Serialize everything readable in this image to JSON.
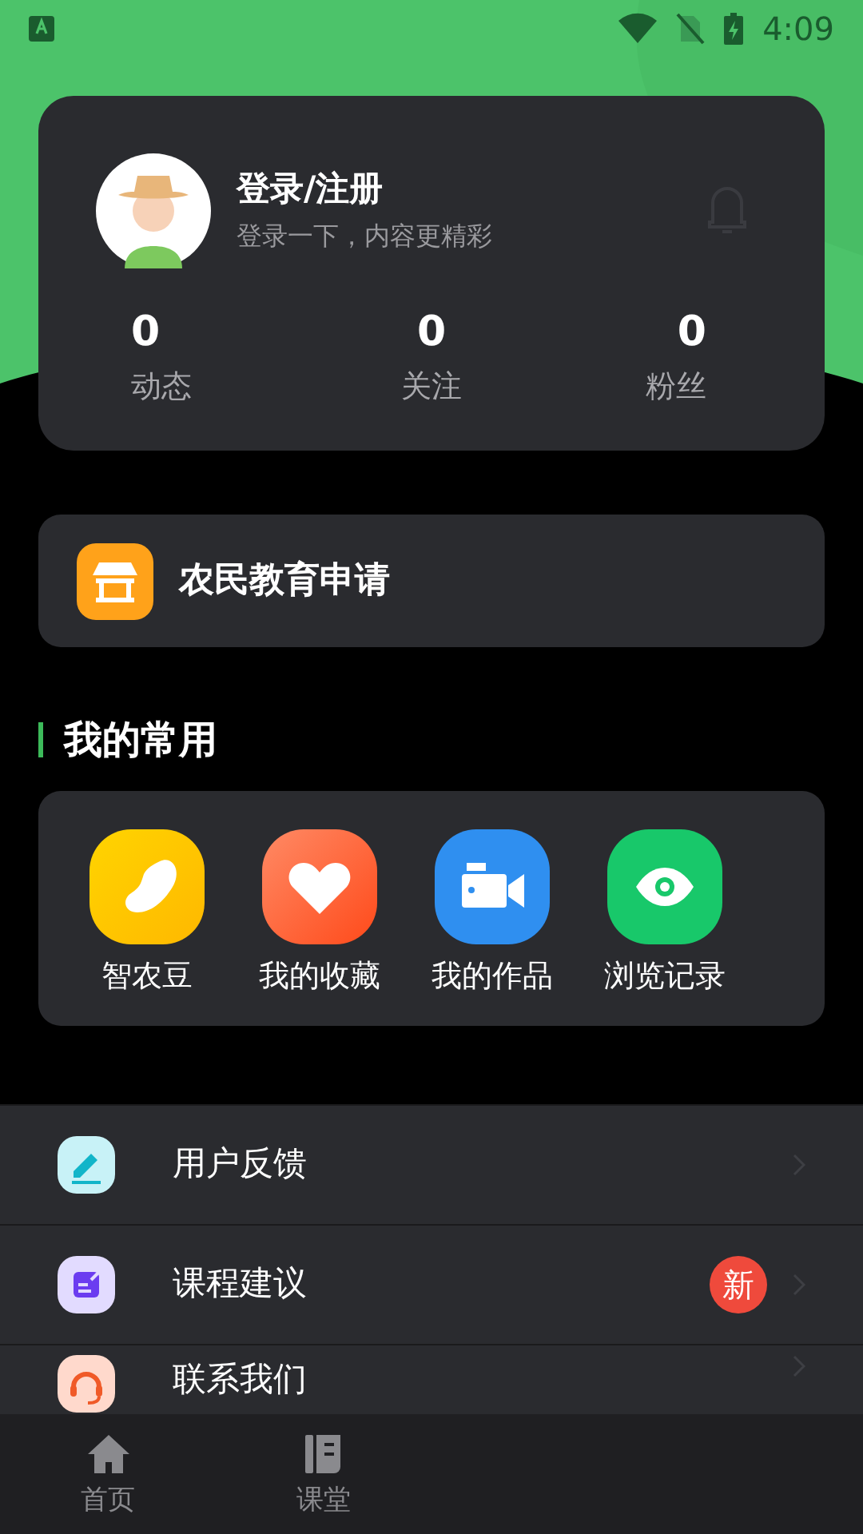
{
  "status_bar": {
    "time": "4:09"
  },
  "profile": {
    "title": "登录/注册",
    "subtitle": "登录一下，内容更精彩",
    "stats": [
      {
        "value": "0",
        "label": "动态"
      },
      {
        "value": "0",
        "label": "关注"
      },
      {
        "value": "0",
        "label": "粉丝"
      }
    ]
  },
  "application": {
    "label": "农民教育申请"
  },
  "favorites": {
    "title": "我的常用",
    "items": [
      {
        "label": "智农豆"
      },
      {
        "label": "我的收藏"
      },
      {
        "label": "我的作品"
      },
      {
        "label": "浏览记录"
      }
    ]
  },
  "menu": [
    {
      "label": "用户反馈"
    },
    {
      "label": "课程建议",
      "badge": "新"
    },
    {
      "label": "联系我们"
    }
  ],
  "bottom_nav": [
    {
      "label": "首页",
      "selected": false
    },
    {
      "label": "课堂",
      "selected": false
    }
  ]
}
